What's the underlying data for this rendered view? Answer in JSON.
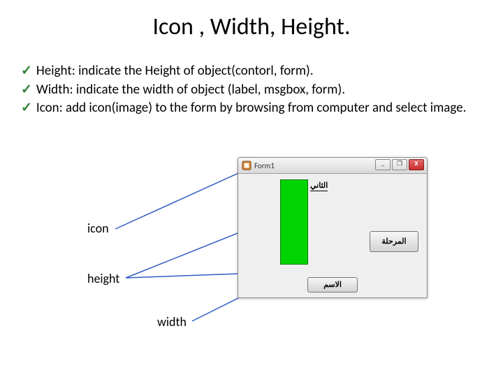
{
  "title": "Icon , Width, Height.",
  "bullets": {
    "b1": "Height: indicate the Height of object(contorl, form).",
    "b2": "Width: indicate the width of object (label, msgbox, form).",
    "b3": "Icon: add icon(image) to the form by browsing from computer and select image."
  },
  "annotations": {
    "icon": "icon",
    "height": "height",
    "width": "width"
  },
  "form": {
    "title": "Form1",
    "label_top": "الثاني",
    "button1": "المرحلة",
    "button2": "الاسم",
    "win": {
      "min": "_",
      "max": "❐",
      "close": "X"
    }
  }
}
